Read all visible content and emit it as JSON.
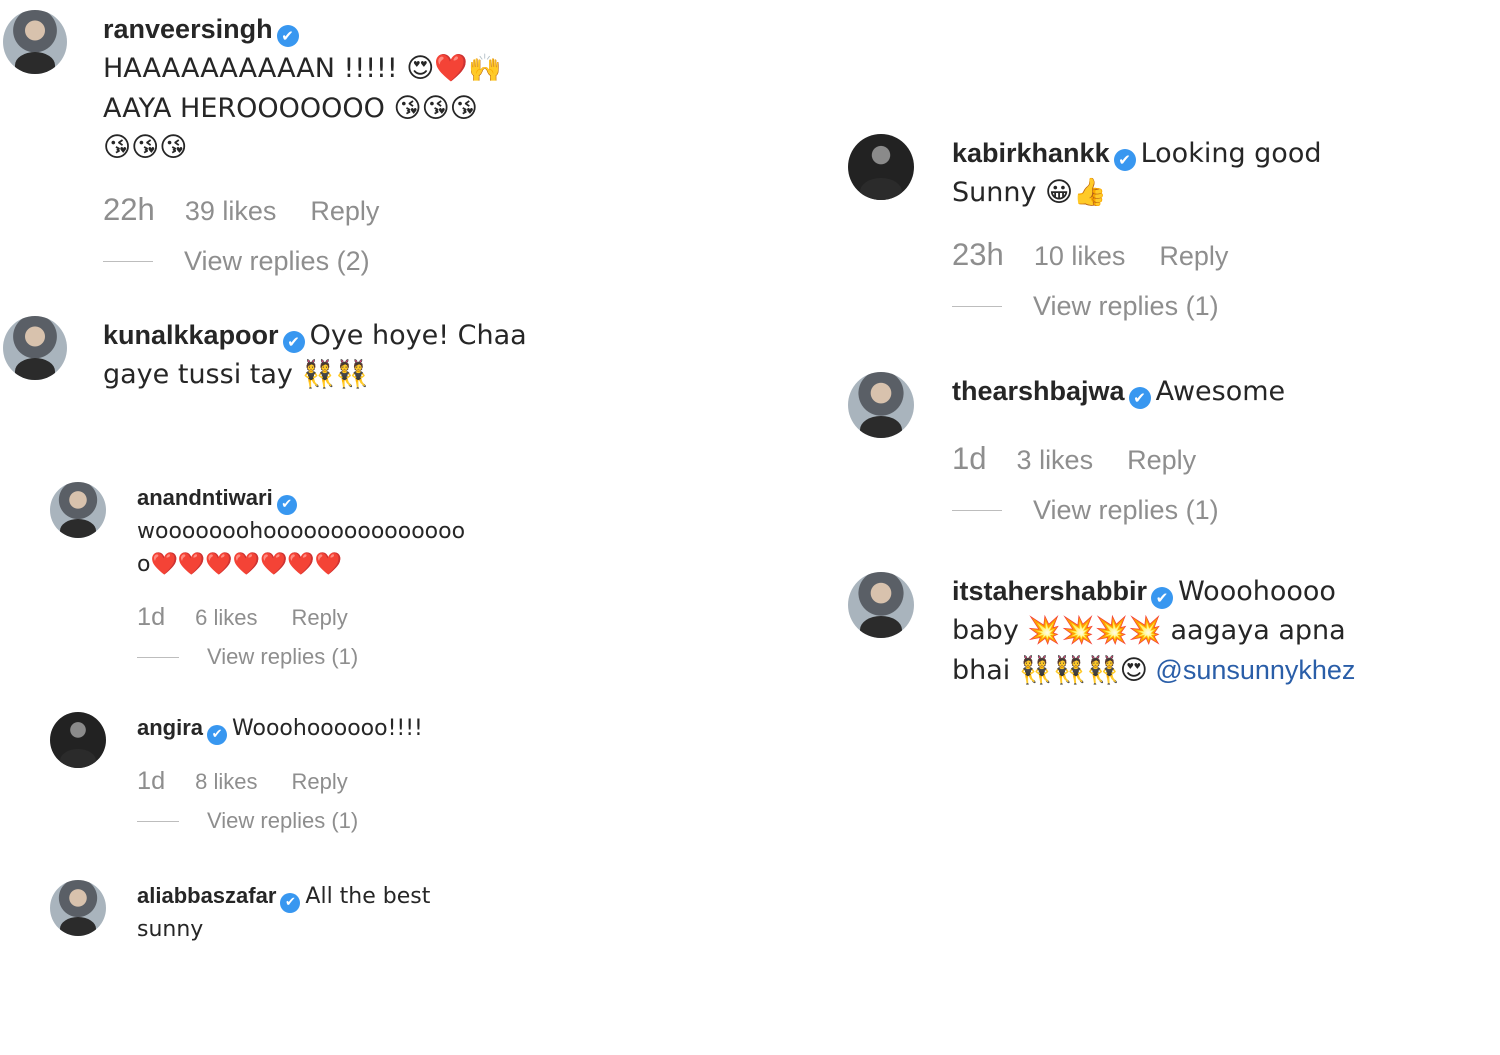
{
  "comments_left": [
    {
      "username": "ranveersingh",
      "verified_icon": "✔",
      "lines": [
        "HAAAAAAAAAAN !!!!! 😍❤️🙌",
        "AAYA HEROOOOOOO 😘😘😘",
        "😘😘😘"
      ],
      "time": "22h",
      "likes": "39 likes",
      "reply": "Reply",
      "view_replies": "View replies (2)"
    },
    {
      "username": "kunalkkapoor",
      "verified_icon": "✔",
      "lines": [
        "Oye hoye! Chaa",
        "gaye tussi tay 👯👯"
      ]
    },
    {
      "username": "anandntiwari",
      "verified_icon": "✔",
      "lines": [
        "wooooooohooooooooooooooo",
        "o❤️❤️❤️❤️❤️❤️❤️"
      ],
      "time": "1d",
      "likes": "6 likes",
      "reply": "Reply",
      "view_replies": "View replies (1)"
    },
    {
      "username": "angira",
      "verified_icon": "✔",
      "lines": [
        "Wooohoooooo!!!!"
      ],
      "time": "1d",
      "likes": "8 likes",
      "reply": "Reply",
      "view_replies": "View replies (1)"
    },
    {
      "username": "aliabbaszafar",
      "verified_icon": "✔",
      "lines": [
        "All the best",
        "sunny"
      ]
    }
  ],
  "comments_right": [
    {
      "username": "kabirkhankk",
      "verified_icon": "✔",
      "lines": [
        "Looking good",
        "Sunny 😀👍"
      ],
      "time": "23h",
      "likes": "10 likes",
      "reply": "Reply",
      "view_replies": "View replies (1)"
    },
    {
      "username": "thearshbajwa",
      "verified_icon": "✔",
      "lines": [
        "Awesome"
      ],
      "time": "1d",
      "likes": "3 likes",
      "reply": "Reply",
      "view_replies": "View replies (1)"
    },
    {
      "username": "itstahershabbir",
      "verified_icon": "✔",
      "lines": [
        "Wooohoooo",
        "baby 💥💥💥💥 aagaya apna",
        "bhai 👯👯👯😍"
      ],
      "mention": "@sunsunnykhez"
    }
  ],
  "colors": {
    "verified": "#3897f0",
    "meta": "#8e8e8e",
    "mention": "#2a5ea8"
  }
}
